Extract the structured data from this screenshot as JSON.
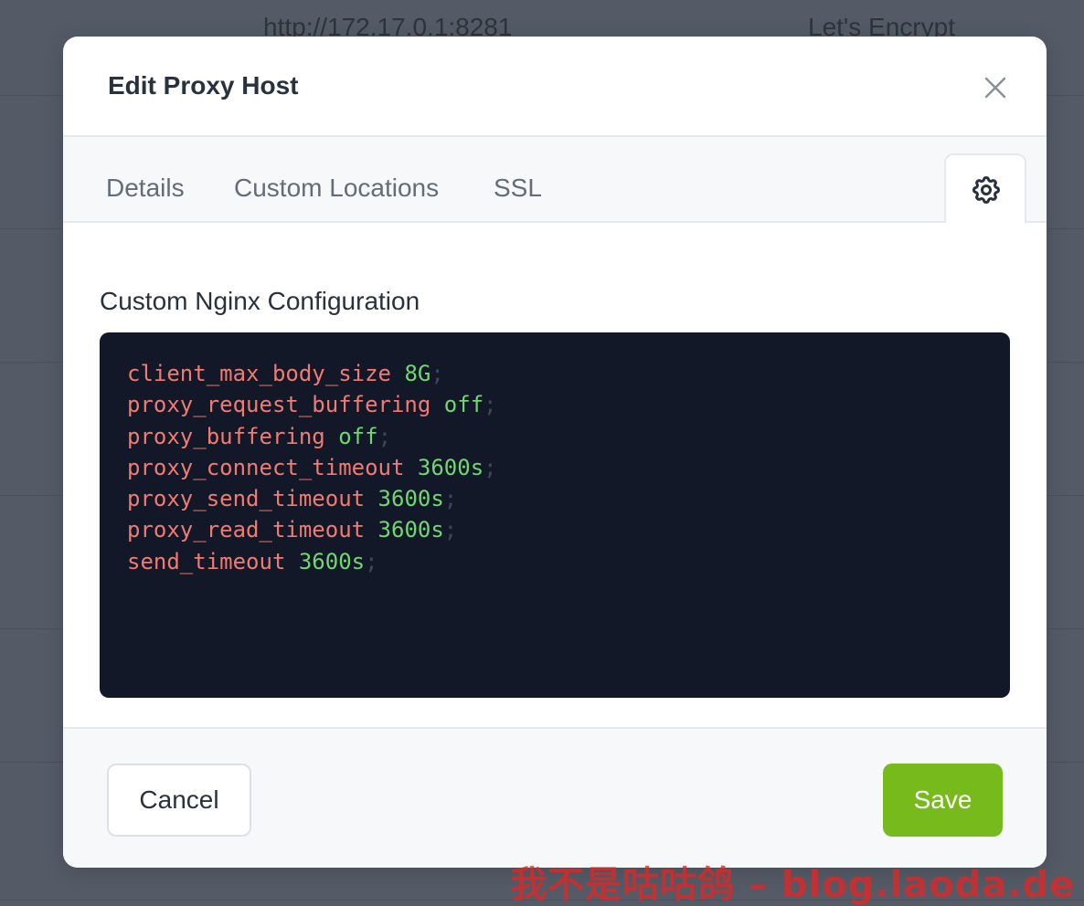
{
  "background": {
    "row_texts": {
      "forward": "http://172.17.0.1:8281",
      "ssl": "Let's Encrypt"
    }
  },
  "modal": {
    "title": "Edit Proxy Host",
    "close_icon": "close-icon",
    "tabs": [
      {
        "label": "Details",
        "active": false
      },
      {
        "label": "Custom Locations",
        "active": false
      },
      {
        "label": "SSL",
        "active": false
      }
    ],
    "settings_tab_icon": "gear-icon",
    "section_label": "Custom Nginx Configuration",
    "code_lines": [
      {
        "directive": "client_max_body_size",
        "value": "8G",
        "end": ";"
      },
      {
        "directive": "proxy_request_buffering",
        "value": "off",
        "end": ";"
      },
      {
        "directive": "proxy_buffering",
        "value": "off",
        "end": ";"
      },
      {
        "directive": "proxy_connect_timeout",
        "value": "3600s",
        "end": ";"
      },
      {
        "directive": "proxy_send_timeout",
        "value": "3600s",
        "end": ";"
      },
      {
        "directive": "proxy_read_timeout",
        "value": "3600s",
        "end": ";"
      },
      {
        "directive": "send_timeout",
        "value": "3600s",
        "end": ";"
      }
    ],
    "footer": {
      "cancel_label": "Cancel",
      "save_label": "Save"
    }
  },
  "colors": {
    "save_button": "#76ba1b",
    "editor_background": "#121828",
    "directive": "#f07b72",
    "value": "#72d672"
  },
  "watermark": "我不是咕咕鸽 – blog.laoda.de"
}
